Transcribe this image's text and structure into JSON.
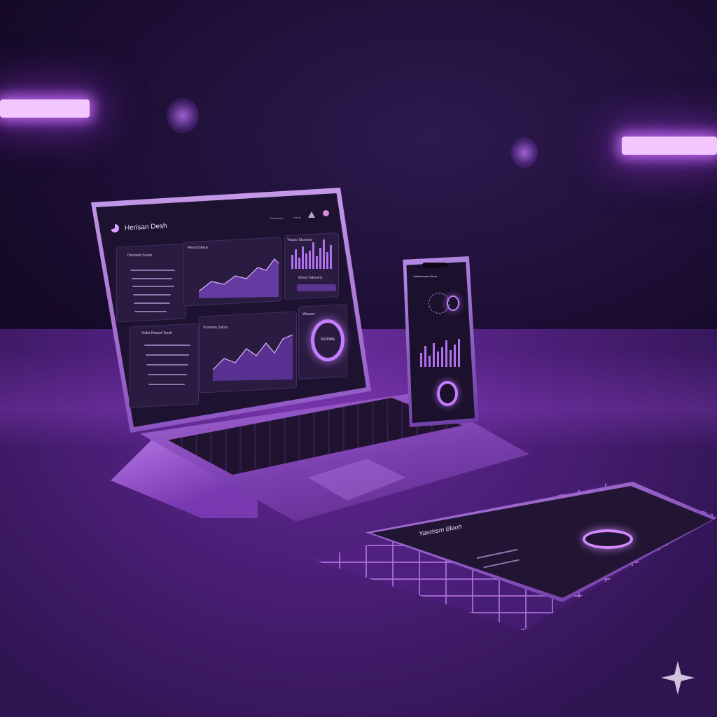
{
  "colors": {
    "wall": "#1f1038",
    "table": "#4c1f78",
    "neon": "#f2c6ff",
    "accent": "#c57dff",
    "screen_bg": "#1d1230",
    "card_bg": "#2a1c40"
  },
  "laptop": {
    "app_title": "Herisan Desh",
    "nav": [
      "Dssnwsns",
      "Yuzols"
    ],
    "cards": {
      "top_left": {
        "title": "Dssnsws Ssosh"
      },
      "top_middle": {
        "title": "Ressod Asos"
      },
      "top_right": {
        "title": "Youssr Stsonow",
        "subtitle": "Wuoa Yaksoms"
      },
      "bottom_left": {
        "title": "Yotba Nsssnt Tsosh"
      },
      "bottom_middle": {
        "title": "Sossswu Sylors"
      },
      "bottom_right": {
        "title": "Wassos",
        "ring_label": "SSDNBE"
      }
    }
  },
  "phone": {
    "title": "Yadlesnnssis Blcob"
  },
  "tablet": {
    "title": "Yasrissm Bleoh"
  },
  "icons": [
    "logo-icon",
    "sparkle-icon"
  ]
}
